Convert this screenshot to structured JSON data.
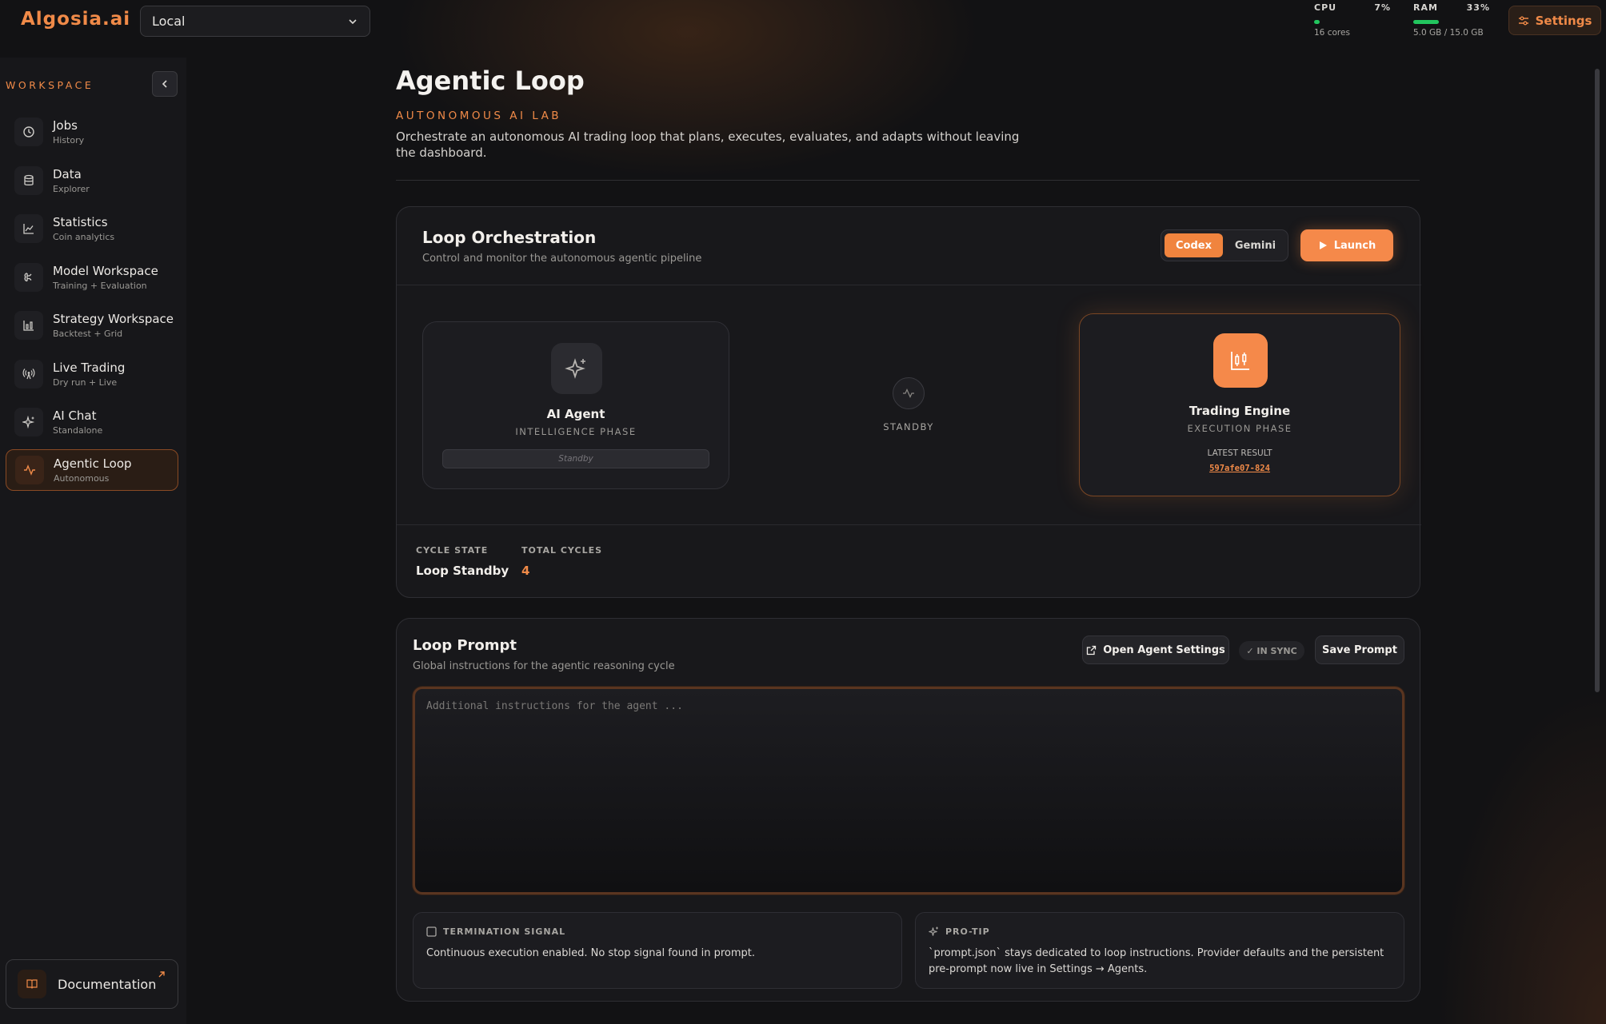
{
  "app": {
    "logo": "Algosia.ai",
    "environment": "Local",
    "settings_label": "Settings",
    "metrics": {
      "cpu": {
        "label": "CPU",
        "percent": "7%",
        "sub": "16 cores",
        "fill": 0.07
      },
      "ram": {
        "label": "RAM",
        "percent": "33%",
        "sub": "5.0 GB / 15.0 GB",
        "fill": 0.33
      }
    },
    "accent": "#f08a48"
  },
  "sidebar": {
    "section_label": "WORKSPACE",
    "items": [
      {
        "label": "Jobs",
        "sub": "History",
        "icon": "clock-icon"
      },
      {
        "label": "Data",
        "sub": "Explorer",
        "icon": "database-icon"
      },
      {
        "label": "Statistics",
        "sub": "Coin analytics",
        "icon": "line-chart-icon"
      },
      {
        "label": "Model Workspace",
        "sub": "Training + Evaluation",
        "icon": "brain-icon"
      },
      {
        "label": "Strategy Workspace",
        "sub": "Backtest + Grid",
        "icon": "bar-chart-icon"
      },
      {
        "label": "Live Trading",
        "sub": "Dry run + Live",
        "icon": "radio-tower-icon"
      },
      {
        "label": "AI Chat",
        "sub": "Standalone",
        "icon": "sparkles-icon"
      },
      {
        "label": "Agentic Loop",
        "sub": "Autonomous",
        "icon": "activity-icon",
        "active": true
      }
    ],
    "documentation": "Documentation"
  },
  "page": {
    "title": "Agentic Loop",
    "kicker": "AUTONOMOUS AI LAB",
    "description": "Orchestrate an autonomous AI trading loop that plans, executes, evaluates, and adapts without leaving the dashboard."
  },
  "orchestration": {
    "title": "Loop Orchestration",
    "subtitle": "Control and monitor the autonomous agentic pipeline",
    "providers": [
      "Codex",
      "Gemini"
    ],
    "selected_provider": "Codex",
    "launch_label": "Launch",
    "agent": {
      "title": "AI Agent",
      "phase": "INTELLIGENCE PHASE",
      "status": "Standby"
    },
    "link_status": "STANDBY",
    "engine": {
      "title": "Trading Engine",
      "phase": "EXECUTION PHASE",
      "latest_label": "LATEST RESULT",
      "latest_value": "597afe07-824"
    },
    "cycle_state_label": "CYCLE STATE",
    "cycle_state": "Loop Standby",
    "total_cycles_label": "TOTAL CYCLES",
    "total_cycles": "4"
  },
  "prompt": {
    "title": "Loop Prompt",
    "subtitle": "Global instructions for the agentic reasoning cycle",
    "open_settings_label": "Open Agent Settings",
    "sync_label": "✓ IN SYNC",
    "save_label": "Save Prompt",
    "placeholder": "Additional instructions for the agent ...",
    "termination": {
      "label": "TERMINATION SIGNAL",
      "text": "Continuous execution enabled. No stop signal found in prompt."
    },
    "tip": {
      "label": "PRO-TIP",
      "text": "`prompt.json` stays dedicated to loop instructions. Provider defaults and the persistent pre-prompt now live in Settings → Agents."
    }
  }
}
